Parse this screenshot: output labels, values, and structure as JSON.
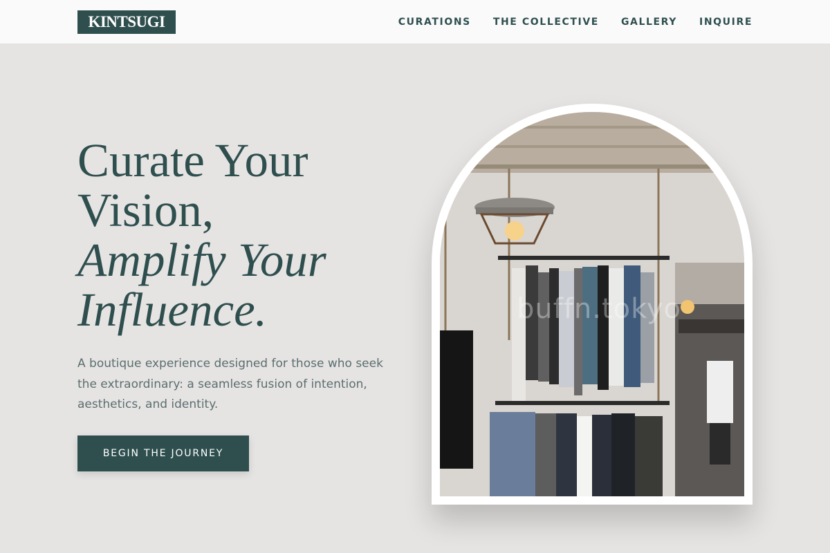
{
  "brand": {
    "logo_text": "KINTSUGI"
  },
  "nav": {
    "items": [
      {
        "label": "CURATIONS"
      },
      {
        "label": "THE COLLECTIVE"
      },
      {
        "label": "GALLERY"
      },
      {
        "label": "INQUIRE"
      }
    ]
  },
  "hero": {
    "title_line1": "Curate Your",
    "title_line2": "Vision,",
    "title_line3": "Amplify Your",
    "title_line4": "Influence.",
    "description": "A boutique experience designed for those who seek the extraordinary: a seamless fusion of intention, aesthetics, and identity.",
    "cta_label": "BEGIN THE JOURNEY"
  },
  "image": {
    "watermark": "buffn.tokyo",
    "subject": "clothing rack boutique interior"
  },
  "colors": {
    "accent": "#2f4f4f",
    "background": "#e6e4e2",
    "header_bg": "#fafafa",
    "body_text": "#5a6e70"
  }
}
